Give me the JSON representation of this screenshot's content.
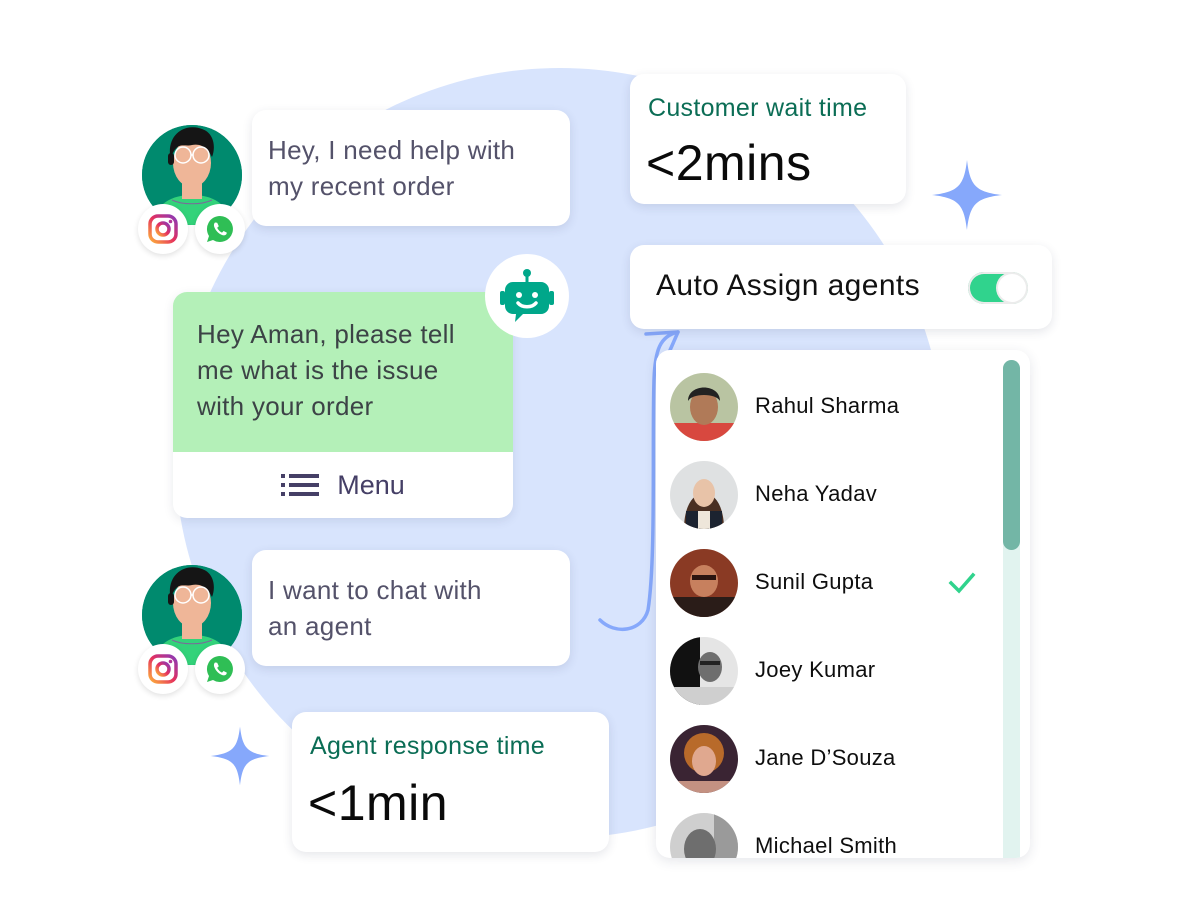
{
  "conversation": {
    "customer_message_1": {
      "line1": "Hey, I need help with",
      "line2": "my recent order"
    },
    "bot_message": {
      "line1": "Hey Aman, please tell",
      "line2": "me what is the issue",
      "line3": "with your order"
    },
    "bot_menu_label": "Menu",
    "customer_message_2": {
      "line1": "I want to chat with",
      "line2": "an agent"
    },
    "channels": [
      "instagram-icon",
      "whatsapp-icon"
    ]
  },
  "metrics": {
    "customer_wait": {
      "label": "Customer wait time",
      "value": "<2mins"
    },
    "agent_response": {
      "label": "Agent response time",
      "value": "<1min"
    }
  },
  "auto_assign": {
    "label": "Auto Assign agents",
    "enabled": true
  },
  "agents": [
    {
      "name": "Rahul Sharma",
      "selected": false
    },
    {
      "name": "Neha Yadav",
      "selected": false
    },
    {
      "name": "Sunil Gupta",
      "selected": true
    },
    {
      "name": "Joey Kumar",
      "selected": false
    },
    {
      "name": "Jane D’Souza",
      "selected": false
    },
    {
      "name": "Michael Smith",
      "selected": false
    }
  ],
  "agents_scroll": {
    "visible_fraction": 0.38,
    "position": 0
  },
  "colors": {
    "background_circle": "#d8e4fd",
    "bot_bubble": "#b4f0b8",
    "metric_label": "#0b6d55",
    "toggle_on": "#30d38d",
    "check": "#30d38d",
    "scroll_thumb": "#73b6a6",
    "scroll_track": "#e1f3ef",
    "sparkle": "#86a8fb",
    "bot_icon": "#00a78a",
    "avatar_bg": "#008a6e"
  }
}
